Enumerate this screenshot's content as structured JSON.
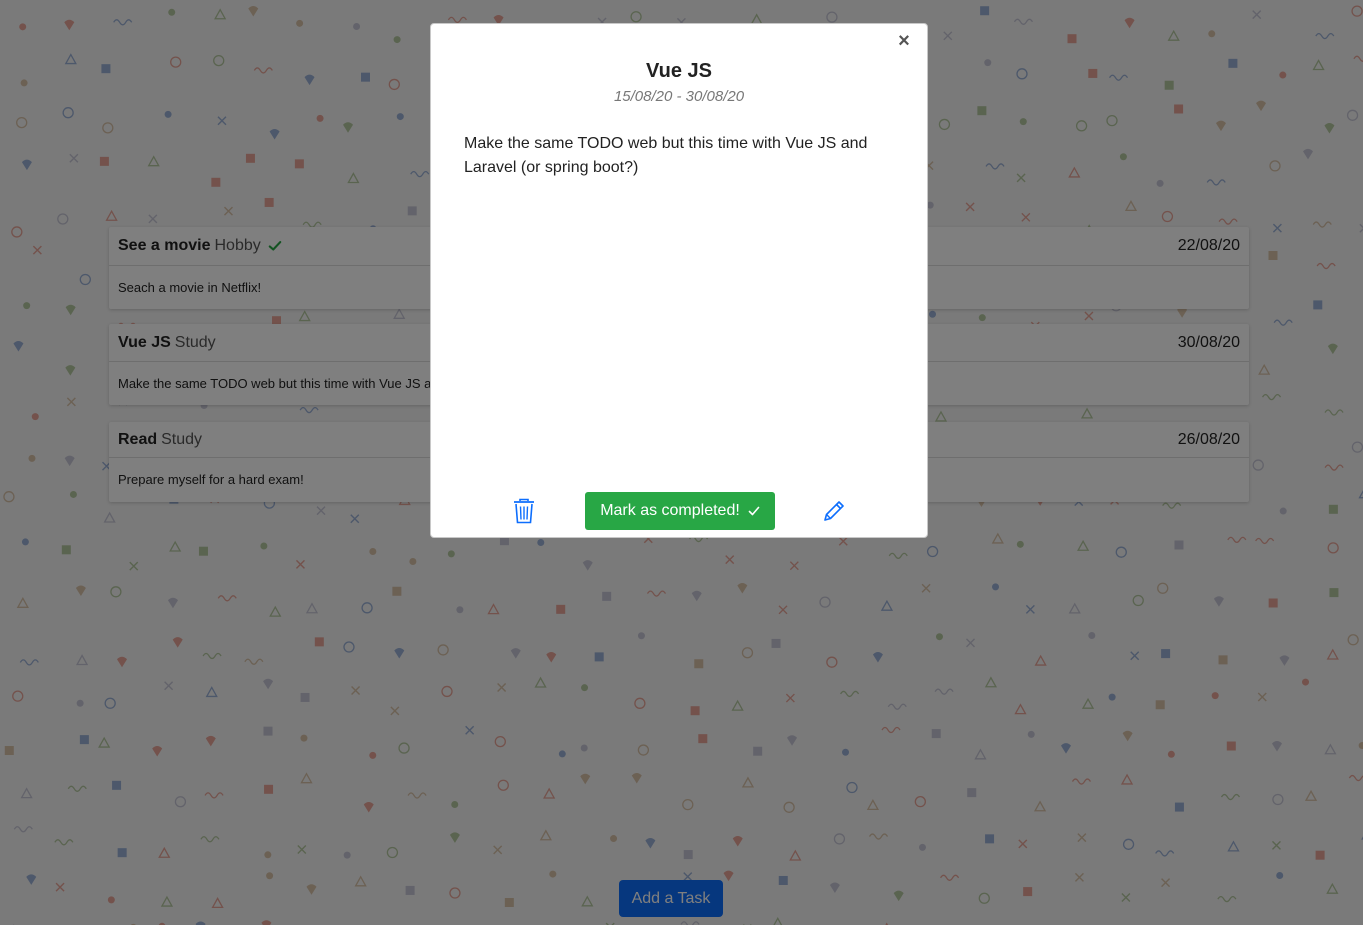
{
  "colors": {
    "accent_blue": "#0d6efd",
    "success_green": "#28a745",
    "overlay": "rgba(0,0,0,0.5)"
  },
  "tasks": [
    {
      "title": "See a movie",
      "category": "Hobby",
      "completed": true,
      "date": "22/08/20",
      "description": "Seach a movie in Netflix!"
    },
    {
      "title": "Vue JS",
      "category": "Study",
      "completed": false,
      "date": "30/08/20",
      "description": "Make the same TODO web but this time with Vue JS and Laravel (or spring boot?)"
    },
    {
      "title": "Read",
      "category": "Study",
      "completed": false,
      "date": "26/08/20",
      "description": "Prepare myself for a hard exam!"
    }
  ],
  "add_task_label": "Add a Task",
  "modal": {
    "close_glyph": "×",
    "title": "Vue JS",
    "dates": "15/08/20 - 30/08/20",
    "description": "Make the same TODO web but this time with Vue JS and Laravel (or spring boot?)",
    "complete_label": "Mark as completed!",
    "icons": [
      "trash-icon",
      "check-icon",
      "pencil-icon",
      "close-icon"
    ]
  }
}
